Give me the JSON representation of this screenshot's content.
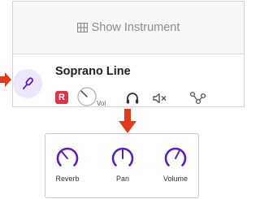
{
  "track": {
    "show_instrument_label": "Show Instrument",
    "name": "Soprano Line",
    "record_badge": "R",
    "volume_label": "Vol"
  },
  "fx": {
    "knobs": [
      {
        "label": "Reverb",
        "level": 0.35
      },
      {
        "label": "Pan",
        "level": 0.5
      },
      {
        "label": "Volume",
        "level": 0.6
      }
    ]
  },
  "colors": {
    "accent_purple": "#5b1fb8",
    "arrow_red": "#e23a1b",
    "record_red": "#e0314b",
    "instrument_bg": "#eee6fb"
  },
  "icons": {
    "instrument": "microphone-icon",
    "show_instrument": "grid-icon",
    "headphones": "headphones-icon",
    "mute": "mute-icon",
    "routing": "routing-icon"
  }
}
